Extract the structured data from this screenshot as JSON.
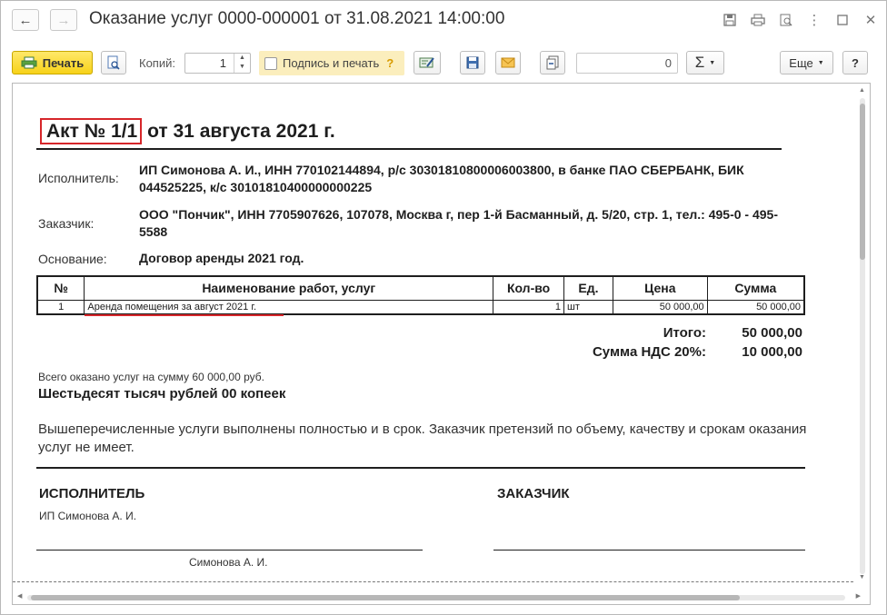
{
  "window": {
    "title": "Оказание услуг 0000-000001 от 31.08.2021 14:00:00"
  },
  "toolbar": {
    "print_label": "Печать",
    "copies_label": "Копий:",
    "copies_value": "1",
    "sign_label": "Подпись и печать",
    "sign_help": "?",
    "number_value": "0",
    "more_label": "Еще",
    "help_label": "?"
  },
  "document": {
    "act_number": "Акт № 1/1",
    "act_date": "от 31 августа 2021 г.",
    "executor_label": "Исполнитель:",
    "executor_value": "ИП Симонова А. И., ИНН 770102144894, р/с 30301810800006003800, в банке ПАО СБЕРБАНК, БИК 044525225, к/с 30101810400000000225",
    "customer_label": "Заказчик:",
    "customer_value": "ООО \"Пончик\", ИНН 7705907626, 107078, Москва г, пер 1-й Басманный, д. 5/20, стр. 1, тел.: 495-0 - 495-5588",
    "basis_label": "Основание:",
    "basis_value": "Договор аренды 2021 год.",
    "table": {
      "headers": [
        "№",
        "Наименование работ, услуг",
        "Кол-во",
        "Ед.",
        "Цена",
        "Сумма"
      ],
      "rows": [
        {
          "num": "1",
          "name": "Аренда помещения за август 2021 г.",
          "qty": "1",
          "unit": "шт",
          "price": "50 000,00",
          "sum": "50 000,00"
        }
      ]
    },
    "total_label": "Итого:",
    "total_value": "50 000,00",
    "vat_label": "Сумма НДС 20%:",
    "vat_value": "10 000,00",
    "total_services": "Всего оказано услуг на сумму 60 000,00 руб.",
    "total_words": "Шестьдесят тысяч рублей 00 копеек",
    "statement": "Вышеперечисленные услуги выполнены полностью и в срок. Заказчик претензий по объему, качеству и срокам оказания услуг не имеет.",
    "executor_heading": "ИСПОЛНИТЕЛЬ",
    "executor_org": "ИП Симонова А. И.",
    "executor_signer": "Симонова А. И.",
    "customer_heading": "ЗАКАЗЧИК"
  },
  "colors": {
    "highlight_red": "#d6262a",
    "print_button": "#f7d219",
    "sign_bg": "#fbeebd"
  }
}
